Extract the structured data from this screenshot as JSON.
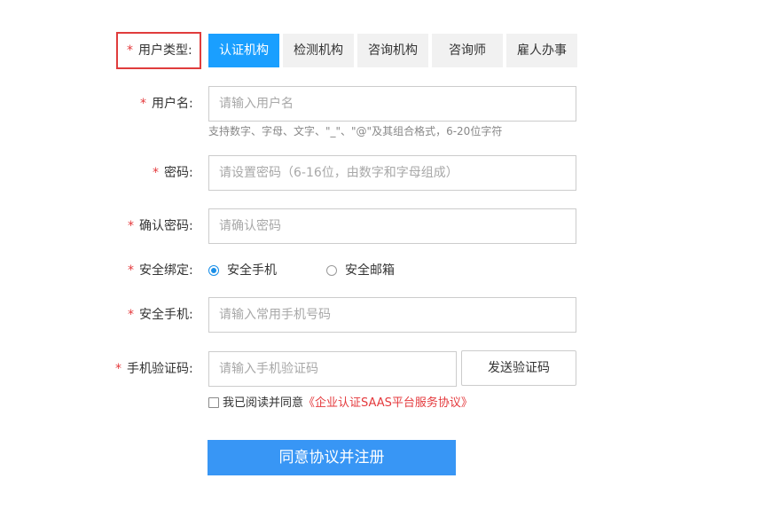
{
  "form": {
    "user_type": {
      "required_mark": "*",
      "label": "用户类型:",
      "tabs": [
        {
          "label": "认证机构",
          "active": true
        },
        {
          "label": "检测机构",
          "active": false
        },
        {
          "label": "咨询机构",
          "active": false
        },
        {
          "label": "咨询师",
          "active": false
        },
        {
          "label": "雇人办事",
          "active": false
        }
      ]
    },
    "username": {
      "required_mark": "*",
      "label": "用户名:",
      "placeholder": "请输入用户名",
      "hint": "支持数字、字母、文字、\"_\"、\"@\"及其组合格式，6-20位字符"
    },
    "password": {
      "required_mark": "*",
      "label": "密码:",
      "placeholder": "请设置密码（6-16位，由数字和字母组成）"
    },
    "confirm_password": {
      "required_mark": "*",
      "label": "确认密码:",
      "placeholder": "请确认密码"
    },
    "security_binding": {
      "required_mark": "*",
      "label": "安全绑定:",
      "options": [
        {
          "label": "安全手机",
          "checked": true
        },
        {
          "label": "安全邮箱",
          "checked": false
        }
      ]
    },
    "phone": {
      "required_mark": "*",
      "label": "安全手机:",
      "placeholder": "请输入常用手机号码"
    },
    "sms_code": {
      "required_mark": "*",
      "label": "手机验证码:",
      "placeholder": "请输入手机验证码",
      "send_button": "发送验证码"
    },
    "agreement": {
      "text": "我已阅读并同意",
      "link": "《企业认证SAAS平台服务协议》",
      "checked": false
    },
    "submit_label": "同意协议并注册"
  },
  "colors": {
    "accent": "#1a9fff",
    "submit": "#3896f5",
    "required": "#e4393c",
    "highlight_border": "#e03c3c"
  }
}
